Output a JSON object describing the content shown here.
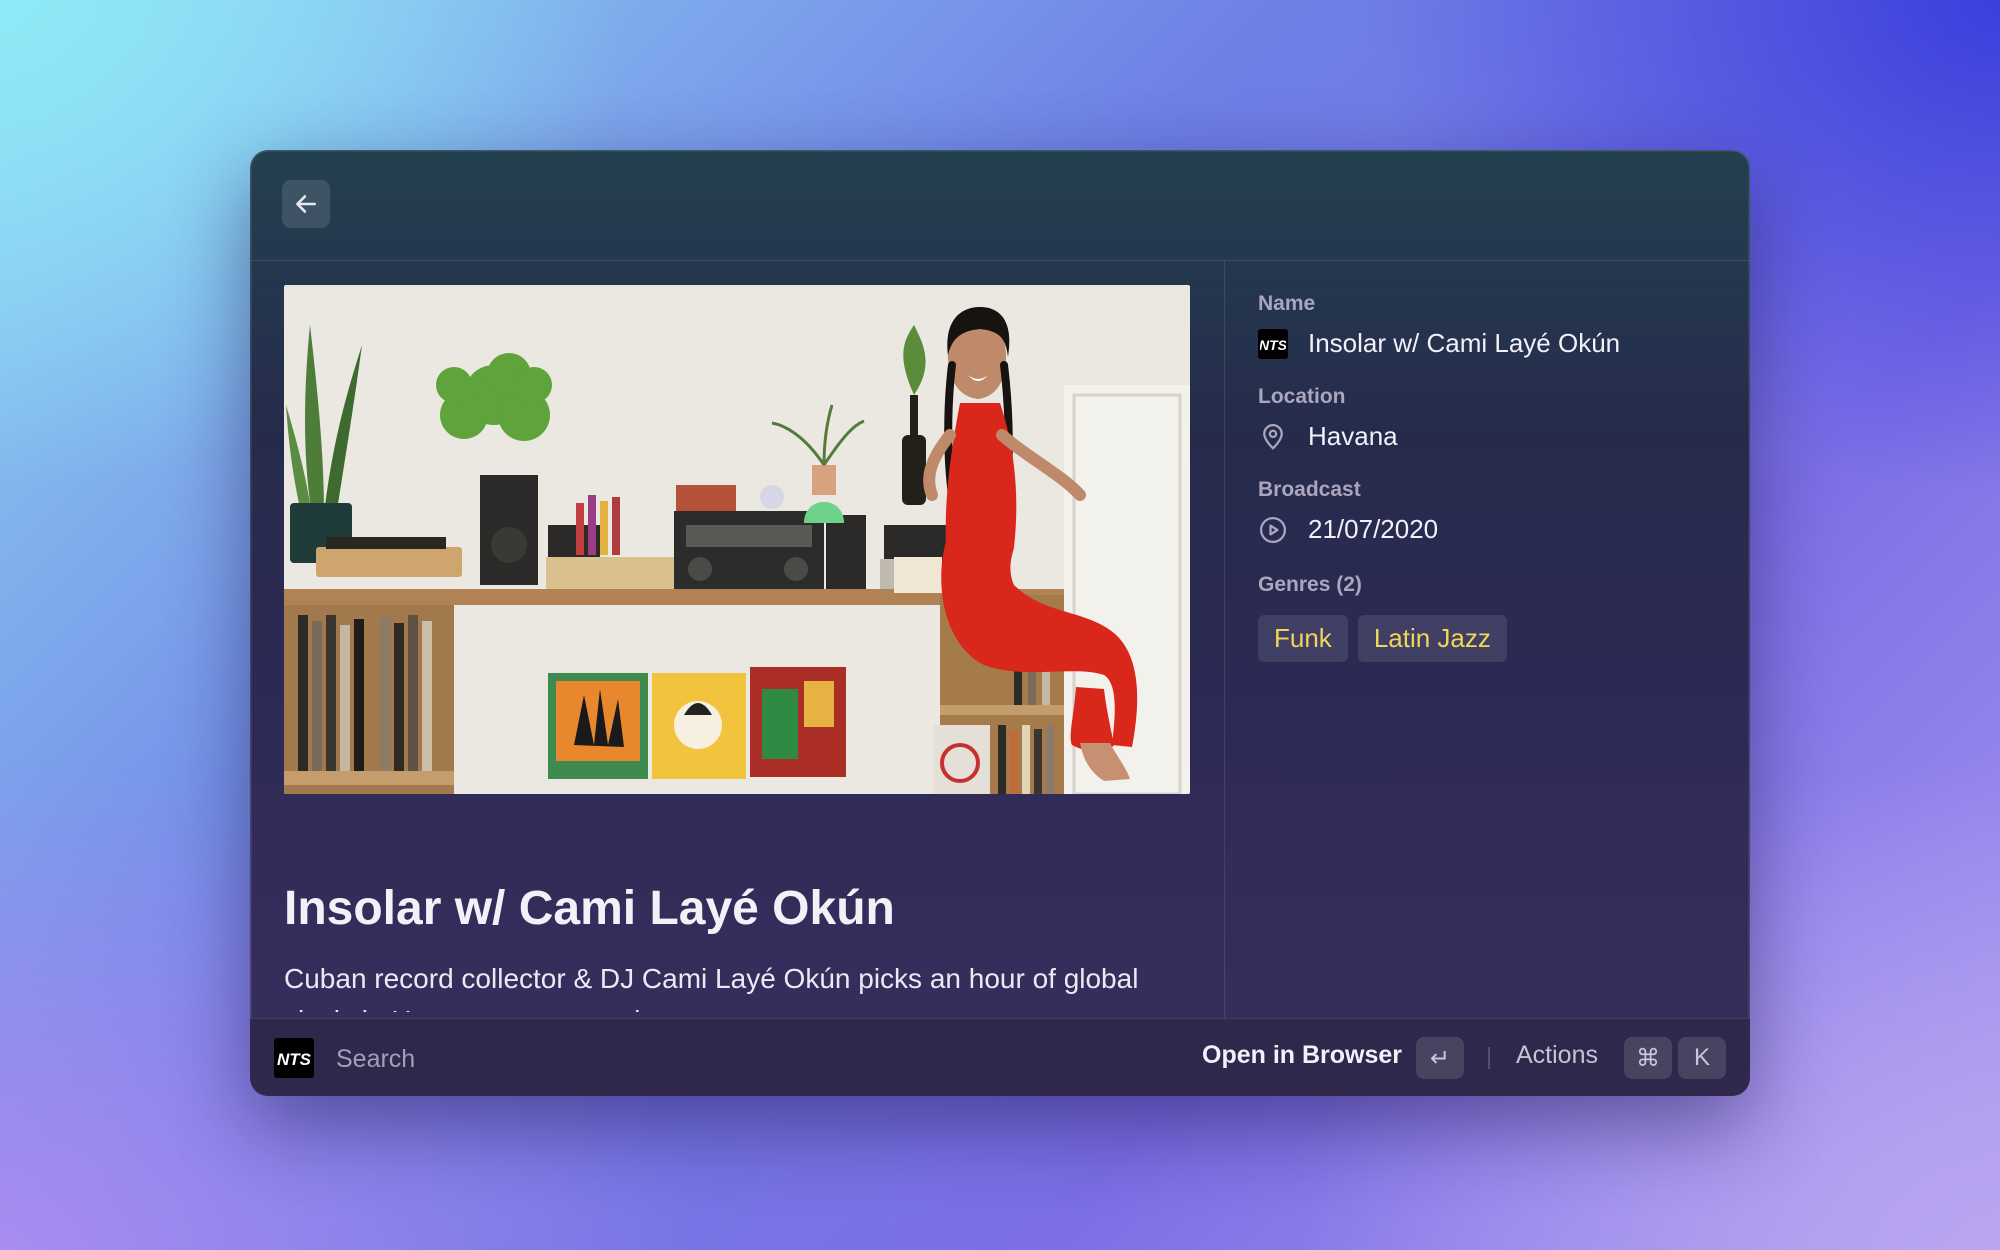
{
  "detail": {
    "title": "Insolar w/ Cami Layé Okún",
    "description": "Cuban record collector & DJ Cami Layé Okún picks an hour of global vinyl via Havana every month."
  },
  "metadata": {
    "name_label": "Name",
    "name_value": "Insolar w/ Cami Layé Okún",
    "location_label": "Location",
    "location_value": "Havana",
    "broadcast_label": "Broadcast",
    "broadcast_value": "21/07/2020",
    "genres_label": "Genres (2)",
    "genres": [
      "Funk",
      "Latin Jazz"
    ]
  },
  "logo_text": "NTS",
  "bottombar": {
    "search_placeholder": "Search",
    "primary_action": "Open in Browser",
    "enter_key": "↵",
    "actions_label": "Actions",
    "cmd_key": "⌘",
    "k_key": "K"
  },
  "colors": {
    "tag_text": "#f0d55a",
    "dress": "#d9271c"
  }
}
